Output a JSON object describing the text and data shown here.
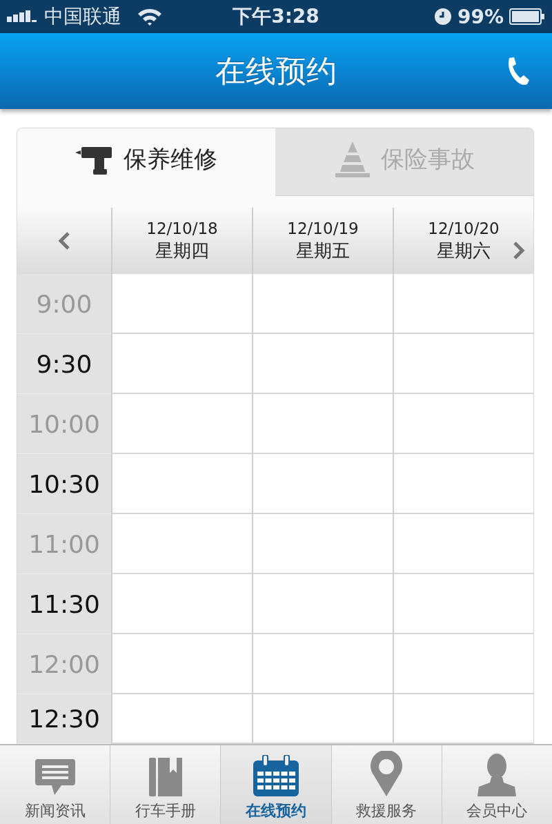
{
  "status_bar": {
    "carrier": "中国联通",
    "time": "下午3:28",
    "battery": "99%"
  },
  "header": {
    "title": "在线预约"
  },
  "tabs": [
    {
      "label": "保养维修",
      "kind": "drill",
      "selected": true
    },
    {
      "label": "保险事故",
      "kind": "cone",
      "selected": false
    }
  ],
  "days": [
    {
      "date": "12/10/18",
      "weekday": "星期四"
    },
    {
      "date": "12/10/19",
      "weekday": "星期五"
    },
    {
      "date": "12/10/20",
      "weekday": "星期六"
    }
  ],
  "times": [
    {
      "label": "9:00",
      "disabled": true
    },
    {
      "label": "9:30",
      "disabled": false
    },
    {
      "label": "10:00",
      "disabled": true
    },
    {
      "label": "10:30",
      "disabled": false
    },
    {
      "label": "11:00",
      "disabled": true
    },
    {
      "label": "11:30",
      "disabled": false
    },
    {
      "label": "12:00",
      "disabled": true
    },
    {
      "label": "12:30",
      "disabled": false
    }
  ],
  "tab_bar": [
    {
      "label": "新闻资讯",
      "kind": "chat",
      "selected": false
    },
    {
      "label": "行车手册",
      "kind": "book",
      "selected": false
    },
    {
      "label": "在线预约",
      "kind": "calendar",
      "selected": true
    },
    {
      "label": "救援服务",
      "kind": "pin",
      "selected": false
    },
    {
      "label": "会员中心",
      "kind": "person",
      "selected": false
    }
  ]
}
